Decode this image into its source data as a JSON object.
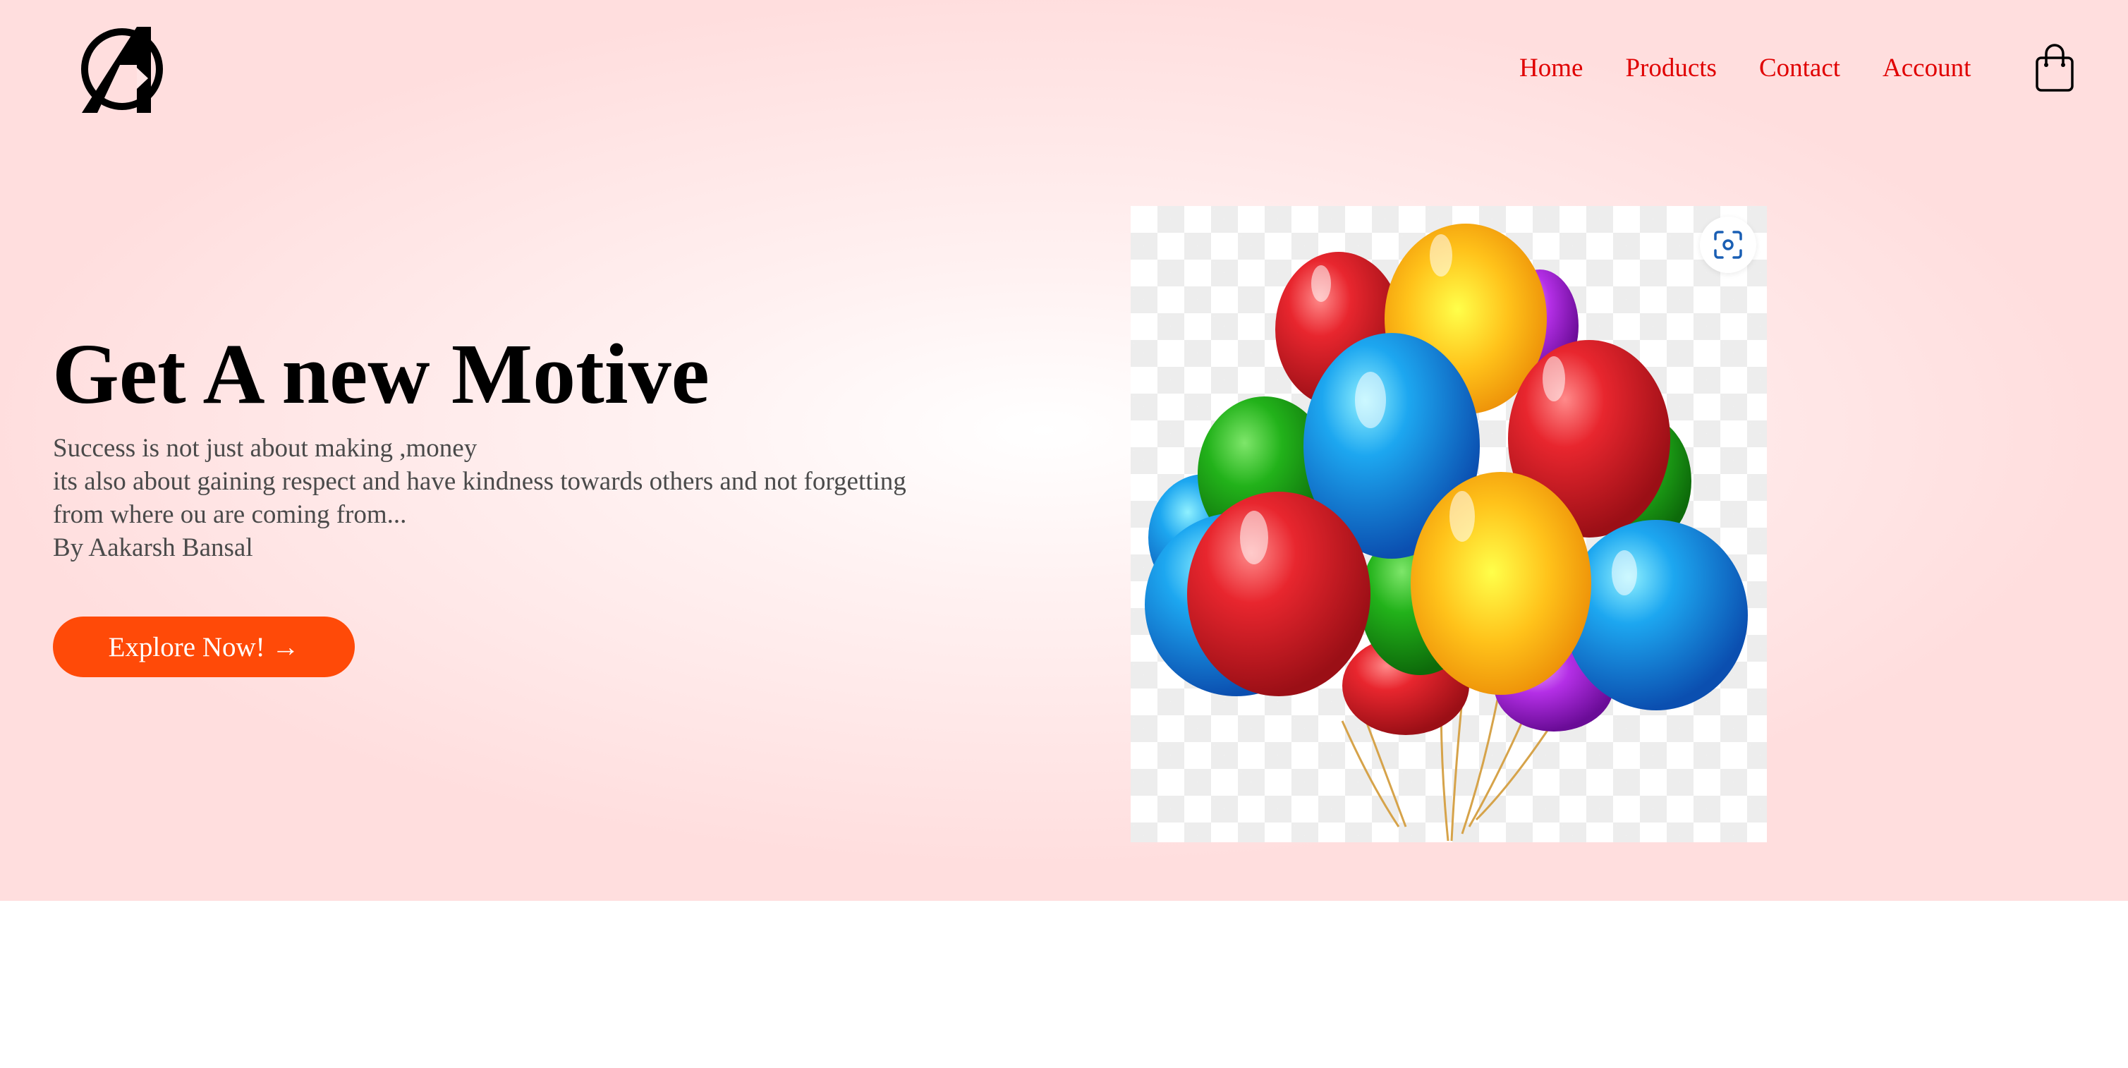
{
  "header": {
    "logo": "avengers-logo",
    "nav": {
      "home": "Home",
      "products": "Products",
      "contact": "Contact",
      "account": "Account"
    },
    "cart_icon": "shopping-bag-icon"
  },
  "hero": {
    "title": "Get A new Motive",
    "description": {
      "line1": "Success is not just about making ,money",
      "line2": "its also about gaining respect and have kindness towards others and not forgetting",
      "line3": "from where ou are coming from...",
      "line4": "By Aakarsh Bansal"
    },
    "cta_label": "Explore Now! →",
    "image": "colorful-balloons-image",
    "image_search_icon": "visual-search-icon"
  },
  "colors": {
    "nav_link": "#e00000",
    "cta_background": "#ff4a08",
    "hero_background": "#ffdede"
  }
}
